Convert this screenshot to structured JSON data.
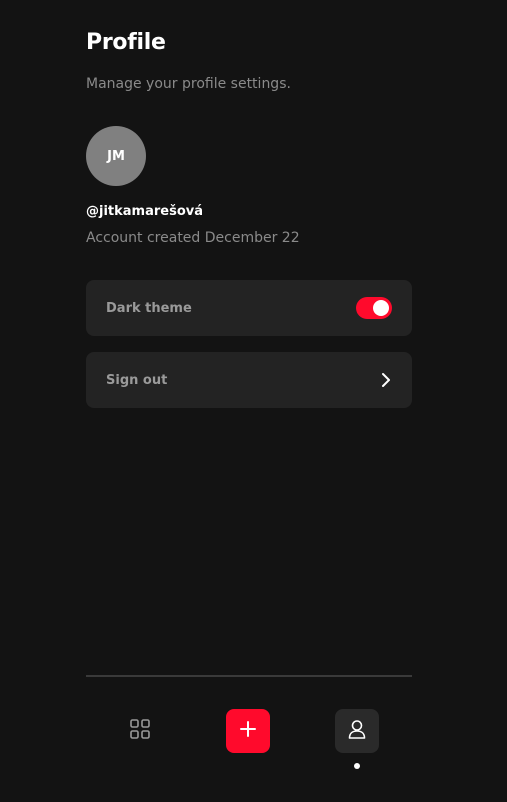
{
  "header": {
    "title": "Profile",
    "subtitle": "Manage your profile settings."
  },
  "profile": {
    "initials": "JM",
    "username": "@jitkamarešová",
    "created": "Account created December 22"
  },
  "settings": {
    "dark_theme_label": "Dark theme",
    "dark_theme_enabled": true,
    "sign_out_label": "Sign out"
  },
  "bottom_nav": {
    "items": [
      {
        "icon": "grid-icon",
        "active": false
      },
      {
        "icon": "plus-icon",
        "active": false
      },
      {
        "icon": "user-icon",
        "active": true
      }
    ]
  },
  "colors": {
    "background": "#131313",
    "card": "#232323",
    "accent": "#ff0a2c",
    "avatar": "#808080",
    "muted_text": "#8a8a8a"
  }
}
